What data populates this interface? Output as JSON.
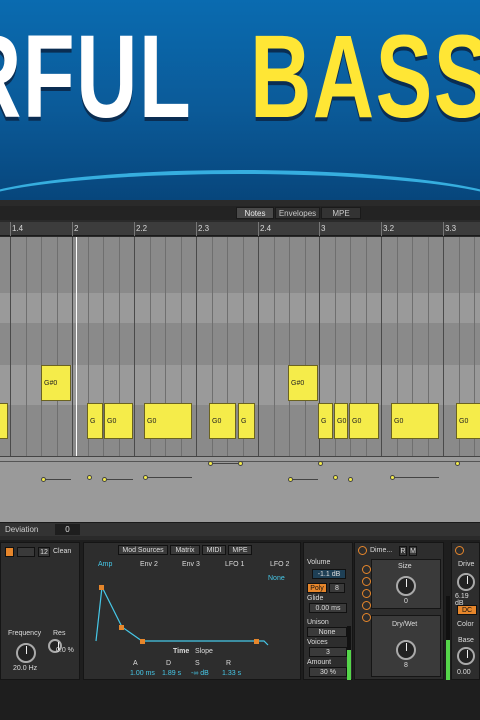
{
  "hero": {
    "title_white": "RFUL",
    "title_yellow": "BASS"
  },
  "tabs": [
    "Notes",
    "Envelopes",
    "MPE"
  ],
  "ruler": [
    "1.4",
    "2",
    "2.2",
    "2.3",
    "2.4",
    "3",
    "3.2",
    "3.3"
  ],
  "notes": [
    {
      "label": "G#0"
    },
    {
      "label": "G#0"
    },
    {
      "label": "G"
    },
    {
      "label": "G0"
    },
    {
      "label": "G0"
    },
    {
      "label": "G0"
    },
    {
      "label": "G"
    },
    {
      "label": "G"
    },
    {
      "label": "G0"
    },
    {
      "label": "G0"
    },
    {
      "label": "G0"
    },
    {
      "label": "G0"
    }
  ],
  "deviation": {
    "label": "Deviation",
    "value": "0"
  },
  "filter": {
    "mode": "Clean",
    "header_num": "12",
    "freq_label": "Frequency",
    "res_label": "Res",
    "freq_value": "20.0 Hz",
    "res_value": "0.0 %"
  },
  "mod": {
    "tabs": [
      "Mod Sources",
      "Matrix",
      "MIDI",
      "MPE"
    ],
    "sources": [
      "Amp",
      "Env 2",
      "Env 3",
      "LFO 1",
      "LFO 2"
    ],
    "none_label": "None",
    "time_label": "Time",
    "slope_label": "Slope",
    "adsr_labels": [
      "A",
      "D",
      "S",
      "R"
    ],
    "adsr_values": [
      "1.00 ms",
      "1.89 s",
      "-∞ dB",
      "1.33 s"
    ]
  },
  "voice": {
    "volume_label": "Volume",
    "volume_value": "-1.1 dB",
    "poly": "Poly",
    "voices_num": "8",
    "glide_label": "Glide",
    "glide_value": "0.00 ms",
    "unison_label": "Unison",
    "unison_value": "None",
    "voices_label": "Voices",
    "voices_value": "3",
    "amount_label": "Amount",
    "amount_value": "30 %"
  },
  "reverb": {
    "name": "Dime...",
    "size_label": "Size",
    "size_value": "0",
    "drywet_label": "Dry/Wet",
    "drywet_value": "8"
  },
  "drive": {
    "drive_label": "Drive",
    "drive_value": "6.19 dB",
    "dc_label": "DC",
    "color_label": "Color",
    "base_label": "Base",
    "base_value": "0.00"
  },
  "colors": {
    "note": "#f5ec4a",
    "accent": "#e6862b",
    "cyan": "#46c8e8",
    "hero_yellow": "#ffe635"
  }
}
